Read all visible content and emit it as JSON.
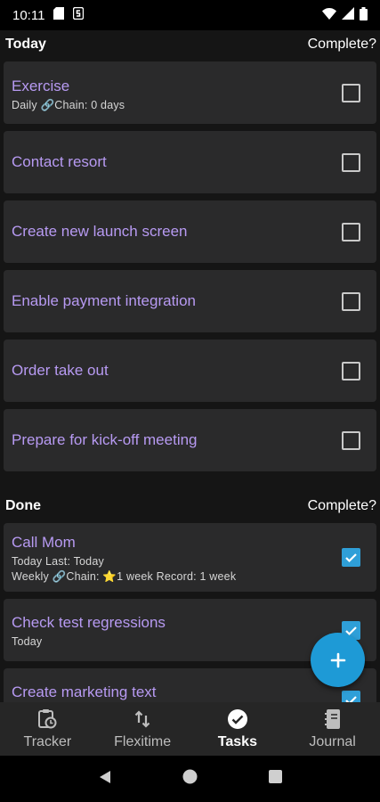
{
  "status_bar": {
    "time": "10:11",
    "icons": [
      "sd-card-icon",
      "s-badge-icon",
      "wifi-icon",
      "signal-icon",
      "battery-icon"
    ]
  },
  "today": {
    "header": "Today",
    "complete_label": "Complete?",
    "tasks": [
      {
        "name": "Exercise",
        "meta": "Daily 🔗Chain: 0 days",
        "checked": false
      },
      {
        "name": "Contact resort",
        "checked": false
      },
      {
        "name": "Create new launch screen",
        "checked": false
      },
      {
        "name": "Enable payment integration",
        "checked": false
      },
      {
        "name": "Order take out",
        "checked": false
      },
      {
        "name": "Prepare for kick-off meeting",
        "checked": false
      }
    ]
  },
  "done": {
    "header": "Done",
    "complete_label": "Complete?",
    "tasks": [
      {
        "name": "Call Mom",
        "meta": "Today Last: Today",
        "meta2": "Weekly 🔗Chain: ⭐1 week Record: 1 week",
        "checked": true
      },
      {
        "name": "Check test regressions",
        "meta": "Today",
        "checked": true
      },
      {
        "name": "Create marketing text",
        "checked": true
      }
    ]
  },
  "fab": {
    "icon": "plus-icon"
  },
  "bottom_nav": [
    {
      "label": "Tracker",
      "icon": "tracker-icon",
      "active": false
    },
    {
      "label": "Flexitime",
      "icon": "flexitime-icon",
      "active": false
    },
    {
      "label": "Tasks",
      "icon": "check-circle-icon",
      "active": true
    },
    {
      "label": "Journal",
      "icon": "journal-icon",
      "active": false
    }
  ],
  "colors": {
    "accent": "#b79af2",
    "fab": "#1e9ad6",
    "checkbox_checked": "#2f9fd8",
    "card": "#2a2a2b",
    "background": "#151515"
  }
}
